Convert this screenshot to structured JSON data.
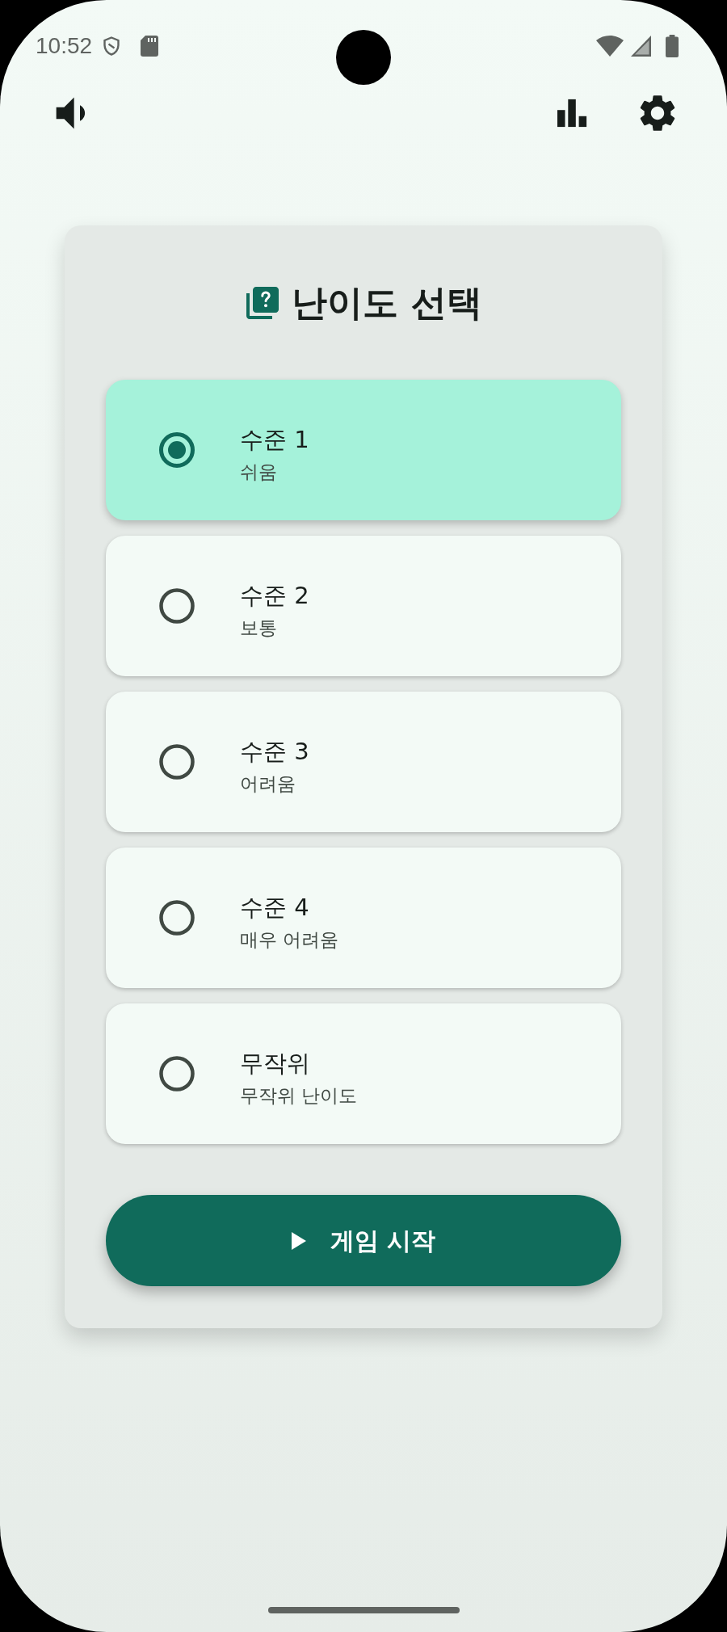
{
  "status_bar": {
    "time": "10:52"
  },
  "difficulty_card": {
    "title": "난이도 선택",
    "options": [
      {
        "label": "수준 1",
        "description": "쉬움",
        "selected": true
      },
      {
        "label": "수준 2",
        "description": "보통",
        "selected": false
      },
      {
        "label": "수준 3",
        "description": "어려움",
        "selected": false
      },
      {
        "label": "수준 4",
        "description": "매우 어려움",
        "selected": false
      },
      {
        "label": "무작위",
        "description": "무작위 난이도",
        "selected": false
      }
    ],
    "start_button": {
      "label": "게임 시작"
    }
  }
}
